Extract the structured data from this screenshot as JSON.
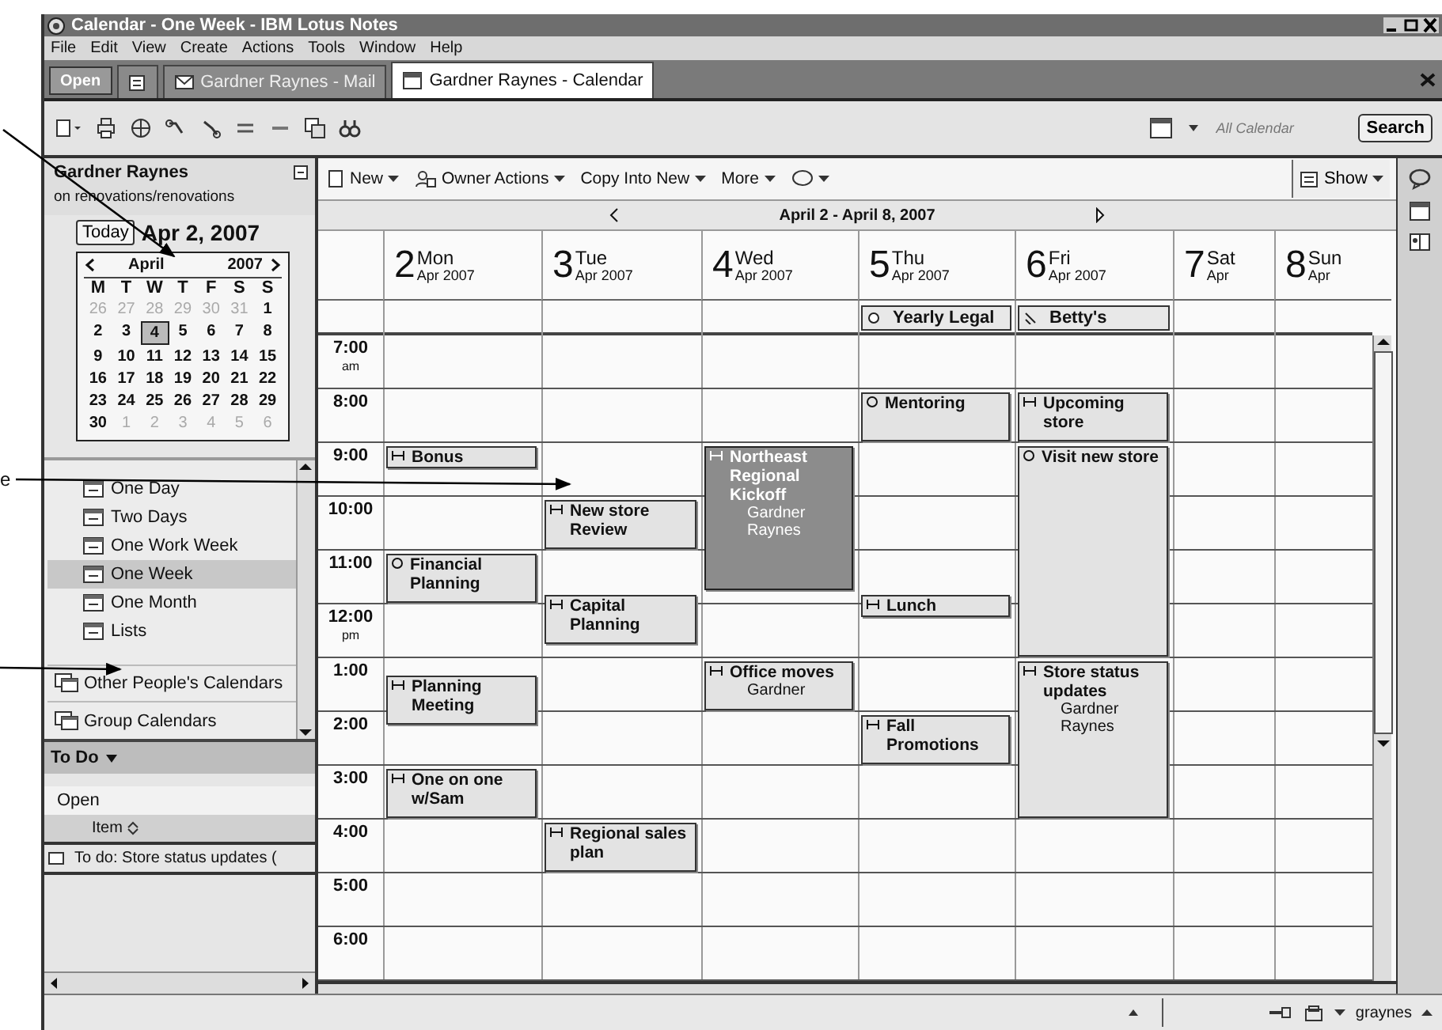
{
  "margin_text": "e",
  "window": {
    "title": "Calendar - One Week - IBM Lotus Notes"
  },
  "menu": [
    "File",
    "Edit",
    "View",
    "Create",
    "Actions",
    "Tools",
    "Window",
    "Help"
  ],
  "open_button": "Open",
  "tabs": [
    {
      "kind": "icon-only",
      "selected": false
    },
    {
      "kind": "mail",
      "label": "Gardner Raynes - Mail",
      "selected": false
    },
    {
      "kind": "calendar",
      "label": "Gardner Raynes - Calendar",
      "selected": true
    }
  ],
  "search": {
    "placeholder": "All Calendar",
    "button": "Search"
  },
  "navigator": {
    "owner": "Gardner Raynes",
    "subtitle": "on renovations/renovations",
    "today_button": "Today",
    "current_date": "Apr 2, 2007",
    "mini_calendar": {
      "month": "April",
      "year": "2007",
      "weekdays": [
        "M",
        "T",
        "W",
        "T",
        "F",
        "S",
        "S"
      ],
      "weeks": [
        [
          {
            "d": "26",
            "outside": true,
            "selected": false
          },
          {
            "d": "27",
            "outside": true,
            "selected": false
          },
          {
            "d": "28",
            "outside": true,
            "selected": false
          },
          {
            "d": "29",
            "outside": true,
            "selected": false
          },
          {
            "d": "30",
            "outside": true,
            "selected": false
          },
          {
            "d": "31",
            "outside": true,
            "selected": false
          },
          {
            "d": "1",
            "outside": false,
            "selected": false
          }
        ],
        [
          {
            "d": "2",
            "outside": false,
            "selected": false
          },
          {
            "d": "3",
            "outside": false,
            "selected": false
          },
          {
            "d": "4",
            "outside": false,
            "selected": true
          },
          {
            "d": "5",
            "outside": false,
            "selected": false
          },
          {
            "d": "6",
            "outside": false,
            "selected": false
          },
          {
            "d": "7",
            "outside": false,
            "selected": false
          },
          {
            "d": "8",
            "outside": false,
            "selected": false
          }
        ],
        [
          {
            "d": "9",
            "outside": false,
            "selected": false
          },
          {
            "d": "10",
            "outside": false,
            "selected": false
          },
          {
            "d": "11",
            "outside": false,
            "selected": false
          },
          {
            "d": "12",
            "outside": false,
            "selected": false
          },
          {
            "d": "13",
            "outside": false,
            "selected": false
          },
          {
            "d": "14",
            "outside": false,
            "selected": false
          },
          {
            "d": "15",
            "outside": false,
            "selected": false
          }
        ],
        [
          {
            "d": "16",
            "outside": false,
            "selected": false
          },
          {
            "d": "17",
            "outside": false,
            "selected": false
          },
          {
            "d": "18",
            "outside": false,
            "selected": false
          },
          {
            "d": "19",
            "outside": false,
            "selected": false
          },
          {
            "d": "20",
            "outside": false,
            "selected": false
          },
          {
            "d": "21",
            "outside": false,
            "selected": false
          },
          {
            "d": "22",
            "outside": false,
            "selected": false
          }
        ],
        [
          {
            "d": "23",
            "outside": false,
            "selected": false
          },
          {
            "d": "24",
            "outside": false,
            "selected": false
          },
          {
            "d": "25",
            "outside": false,
            "selected": false
          },
          {
            "d": "26",
            "outside": false,
            "selected": false
          },
          {
            "d": "27",
            "outside": false,
            "selected": false
          },
          {
            "d": "28",
            "outside": false,
            "selected": false
          },
          {
            "d": "29",
            "outside": false,
            "selected": false
          }
        ],
        [
          {
            "d": "30",
            "outside": false,
            "selected": false
          },
          {
            "d": "1",
            "outside": true,
            "selected": false
          },
          {
            "d": "2",
            "outside": true,
            "selected": false
          },
          {
            "d": "3",
            "outside": true,
            "selected": false
          },
          {
            "d": "4",
            "outside": true,
            "selected": false
          },
          {
            "d": "5",
            "outside": true,
            "selected": false
          },
          {
            "d": "6",
            "outside": true,
            "selected": false
          }
        ]
      ]
    },
    "views": [
      {
        "label": "One Day",
        "selected": false
      },
      {
        "label": "Two Days",
        "selected": false
      },
      {
        "label": "One Work Week",
        "selected": false
      },
      {
        "label": "One Week",
        "selected": true
      },
      {
        "label": "One Month",
        "selected": false
      },
      {
        "label": "Lists",
        "selected": false
      }
    ],
    "sections": [
      "Other People's Calendars",
      "Group Calendars"
    ],
    "todo": {
      "title": "To Do",
      "filter": "Open",
      "column": "Item",
      "items": [
        "To do: Store status updates ("
      ]
    }
  },
  "calendar": {
    "toolbar": [
      "New",
      "Owner Actions",
      "Copy Into New",
      "More"
    ],
    "show_button": "Show",
    "date_range": "April 2 - April 8, 2007",
    "days": [
      {
        "num": "2",
        "name": "Mon",
        "sub": "Apr 2007",
        "events": [
          {
            "kind": "meeting",
            "title": "Bonus",
            "selected": false
          },
          {
            "kind": "reminder",
            "title": "Financial Planning",
            "selected": false
          },
          {
            "kind": "meeting",
            "title": "Planning Meeting",
            "selected": false
          },
          {
            "kind": "meeting",
            "title": "One on one w/Sam",
            "selected": false
          }
        ]
      },
      {
        "num": "3",
        "name": "Tue",
        "sub": "Apr 2007",
        "events": [
          {
            "kind": "meeting",
            "title": "New store Review",
            "selected": false
          },
          {
            "kind": "meeting",
            "title": "Capital Planning",
            "selected": false
          },
          {
            "kind": "meeting",
            "title": "Regional sales plan",
            "selected": false
          }
        ]
      },
      {
        "num": "4",
        "name": "Wed",
        "sub": "Apr 2007",
        "events": [
          {
            "kind": "meeting",
            "title": "Northeast Regional Kickoff",
            "chair": "Gardner Raynes",
            "selected": true
          },
          {
            "kind": "meeting",
            "title": "Office moves",
            "chair": "Gardner",
            "selected": false
          }
        ]
      },
      {
        "num": "5",
        "name": "Thu",
        "sub": "Apr 2007",
        "all_day": [
          {
            "kind": "reminder",
            "title": "Yearly Legal"
          }
        ],
        "events": [
          {
            "kind": "reminder",
            "title": "Mentoring",
            "selected": false
          },
          {
            "kind": "meeting",
            "title": "Lunch",
            "selected": false
          },
          {
            "kind": "meeting",
            "title": "Fall Promotions",
            "selected": false
          }
        ]
      },
      {
        "num": "6",
        "name": "Fri",
        "sub": "Apr 2007",
        "all_day": [
          {
            "kind": "anniversary",
            "title": "Betty's"
          }
        ],
        "events": [
          {
            "kind": "meeting",
            "title": "Upcoming store",
            "selected": false
          },
          {
            "kind": "reminder",
            "title": "Visit new store",
            "selected": false
          },
          {
            "kind": "meeting",
            "title": "Store status updates",
            "chair": "Gardner Raynes",
            "selected": false
          }
        ]
      },
      {
        "num": "7",
        "name": "Sat",
        "sub": "Apr"
      },
      {
        "num": "8",
        "name": "Sun",
        "sub": "Apr"
      }
    ],
    "hours": [
      {
        "time": "7:00",
        "ampm": "am"
      },
      {
        "time": "8:00"
      },
      {
        "time": "9:00"
      },
      {
        "time": "10:00"
      },
      {
        "time": "11:00"
      },
      {
        "time": "12:00",
        "ampm": "pm"
      },
      {
        "time": "1:00"
      },
      {
        "time": "2:00"
      },
      {
        "time": "3:00"
      },
      {
        "time": "4:00"
      },
      {
        "time": "5:00"
      },
      {
        "time": "6:00"
      }
    ]
  },
  "status_bar": {
    "user": "graynes"
  }
}
